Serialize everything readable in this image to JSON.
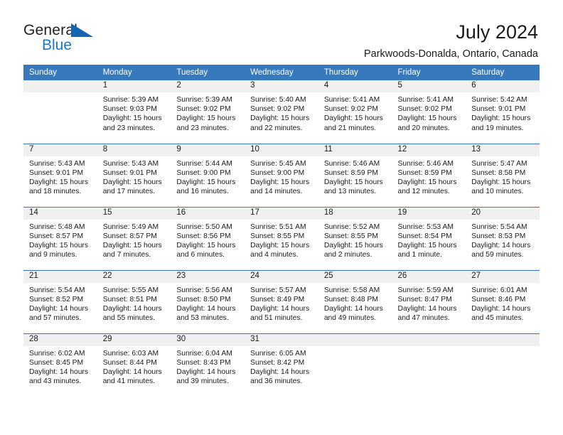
{
  "logo": {
    "word1": "General",
    "word2": "Blue",
    "mark": "triangle-icon"
  },
  "header": {
    "title": "July 2024",
    "subtitle": "Parkwoods-Donalda, Ontario, Canada"
  },
  "colors": {
    "header_blue": "#3679bd",
    "logo_blue": "#1878c8",
    "daynum_band": "#f0f0f0",
    "text": "#1a1a1a"
  },
  "weekday_headers": [
    "Sunday",
    "Monday",
    "Tuesday",
    "Wednesday",
    "Thursday",
    "Friday",
    "Saturday"
  ],
  "labels": {
    "sunrise": "Sunrise:",
    "sunset": "Sunset:",
    "daylight": "Daylight:"
  },
  "weeks": [
    [
      {
        "day": "",
        "empty": true
      },
      {
        "day": "1",
        "line1": "Sunrise: 5:39 AM",
        "line2": "Sunset: 9:03 PM",
        "line3": "Daylight: 15 hours",
        "line4": "and 23 minutes."
      },
      {
        "day": "2",
        "line1": "Sunrise: 5:39 AM",
        "line2": "Sunset: 9:02 PM",
        "line3": "Daylight: 15 hours",
        "line4": "and 23 minutes."
      },
      {
        "day": "3",
        "line1": "Sunrise: 5:40 AM",
        "line2": "Sunset: 9:02 PM",
        "line3": "Daylight: 15 hours",
        "line4": "and 22 minutes."
      },
      {
        "day": "4",
        "line1": "Sunrise: 5:41 AM",
        "line2": "Sunset: 9:02 PM",
        "line3": "Daylight: 15 hours",
        "line4": "and 21 minutes."
      },
      {
        "day": "5",
        "line1": "Sunrise: 5:41 AM",
        "line2": "Sunset: 9:02 PM",
        "line3": "Daylight: 15 hours",
        "line4": "and 20 minutes."
      },
      {
        "day": "6",
        "line1": "Sunrise: 5:42 AM",
        "line2": "Sunset: 9:01 PM",
        "line3": "Daylight: 15 hours",
        "line4": "and 19 minutes."
      }
    ],
    [
      {
        "day": "7",
        "line1": "Sunrise: 5:43 AM",
        "line2": "Sunset: 9:01 PM",
        "line3": "Daylight: 15 hours",
        "line4": "and 18 minutes."
      },
      {
        "day": "8",
        "line1": "Sunrise: 5:43 AM",
        "line2": "Sunset: 9:01 PM",
        "line3": "Daylight: 15 hours",
        "line4": "and 17 minutes."
      },
      {
        "day": "9",
        "line1": "Sunrise: 5:44 AM",
        "line2": "Sunset: 9:00 PM",
        "line3": "Daylight: 15 hours",
        "line4": "and 16 minutes."
      },
      {
        "day": "10",
        "line1": "Sunrise: 5:45 AM",
        "line2": "Sunset: 9:00 PM",
        "line3": "Daylight: 15 hours",
        "line4": "and 14 minutes."
      },
      {
        "day": "11",
        "line1": "Sunrise: 5:46 AM",
        "line2": "Sunset: 8:59 PM",
        "line3": "Daylight: 15 hours",
        "line4": "and 13 minutes."
      },
      {
        "day": "12",
        "line1": "Sunrise: 5:46 AM",
        "line2": "Sunset: 8:59 PM",
        "line3": "Daylight: 15 hours",
        "line4": "and 12 minutes."
      },
      {
        "day": "13",
        "line1": "Sunrise: 5:47 AM",
        "line2": "Sunset: 8:58 PM",
        "line3": "Daylight: 15 hours",
        "line4": "and 10 minutes."
      }
    ],
    [
      {
        "day": "14",
        "line1": "Sunrise: 5:48 AM",
        "line2": "Sunset: 8:57 PM",
        "line3": "Daylight: 15 hours",
        "line4": "and 9 minutes."
      },
      {
        "day": "15",
        "line1": "Sunrise: 5:49 AM",
        "line2": "Sunset: 8:57 PM",
        "line3": "Daylight: 15 hours",
        "line4": "and 7 minutes."
      },
      {
        "day": "16",
        "line1": "Sunrise: 5:50 AM",
        "line2": "Sunset: 8:56 PM",
        "line3": "Daylight: 15 hours",
        "line4": "and 6 minutes."
      },
      {
        "day": "17",
        "line1": "Sunrise: 5:51 AM",
        "line2": "Sunset: 8:55 PM",
        "line3": "Daylight: 15 hours",
        "line4": "and 4 minutes."
      },
      {
        "day": "18",
        "line1": "Sunrise: 5:52 AM",
        "line2": "Sunset: 8:55 PM",
        "line3": "Daylight: 15 hours",
        "line4": "and 2 minutes."
      },
      {
        "day": "19",
        "line1": "Sunrise: 5:53 AM",
        "line2": "Sunset: 8:54 PM",
        "line3": "Daylight: 15 hours",
        "line4": "and 1 minute."
      },
      {
        "day": "20",
        "line1": "Sunrise: 5:54 AM",
        "line2": "Sunset: 8:53 PM",
        "line3": "Daylight: 14 hours",
        "line4": "and 59 minutes."
      }
    ],
    [
      {
        "day": "21",
        "line1": "Sunrise: 5:54 AM",
        "line2": "Sunset: 8:52 PM",
        "line3": "Daylight: 14 hours",
        "line4": "and 57 minutes."
      },
      {
        "day": "22",
        "line1": "Sunrise: 5:55 AM",
        "line2": "Sunset: 8:51 PM",
        "line3": "Daylight: 14 hours",
        "line4": "and 55 minutes."
      },
      {
        "day": "23",
        "line1": "Sunrise: 5:56 AM",
        "line2": "Sunset: 8:50 PM",
        "line3": "Daylight: 14 hours",
        "line4": "and 53 minutes."
      },
      {
        "day": "24",
        "line1": "Sunrise: 5:57 AM",
        "line2": "Sunset: 8:49 PM",
        "line3": "Daylight: 14 hours",
        "line4": "and 51 minutes."
      },
      {
        "day": "25",
        "line1": "Sunrise: 5:58 AM",
        "line2": "Sunset: 8:48 PM",
        "line3": "Daylight: 14 hours",
        "line4": "and 49 minutes."
      },
      {
        "day": "26",
        "line1": "Sunrise: 5:59 AM",
        "line2": "Sunset: 8:47 PM",
        "line3": "Daylight: 14 hours",
        "line4": "and 47 minutes."
      },
      {
        "day": "27",
        "line1": "Sunrise: 6:01 AM",
        "line2": "Sunset: 8:46 PM",
        "line3": "Daylight: 14 hours",
        "line4": "and 45 minutes."
      }
    ],
    [
      {
        "day": "28",
        "line1": "Sunrise: 6:02 AM",
        "line2": "Sunset: 8:45 PM",
        "line3": "Daylight: 14 hours",
        "line4": "and 43 minutes."
      },
      {
        "day": "29",
        "line1": "Sunrise: 6:03 AM",
        "line2": "Sunset: 8:44 PM",
        "line3": "Daylight: 14 hours",
        "line4": "and 41 minutes."
      },
      {
        "day": "30",
        "line1": "Sunrise: 6:04 AM",
        "line2": "Sunset: 8:43 PM",
        "line3": "Daylight: 14 hours",
        "line4": "and 39 minutes."
      },
      {
        "day": "31",
        "line1": "Sunrise: 6:05 AM",
        "line2": "Sunset: 8:42 PM",
        "line3": "Daylight: 14 hours",
        "line4": "and 36 minutes."
      },
      {
        "day": "",
        "empty": true
      },
      {
        "day": "",
        "empty": true
      },
      {
        "day": "",
        "empty": true
      }
    ]
  ]
}
